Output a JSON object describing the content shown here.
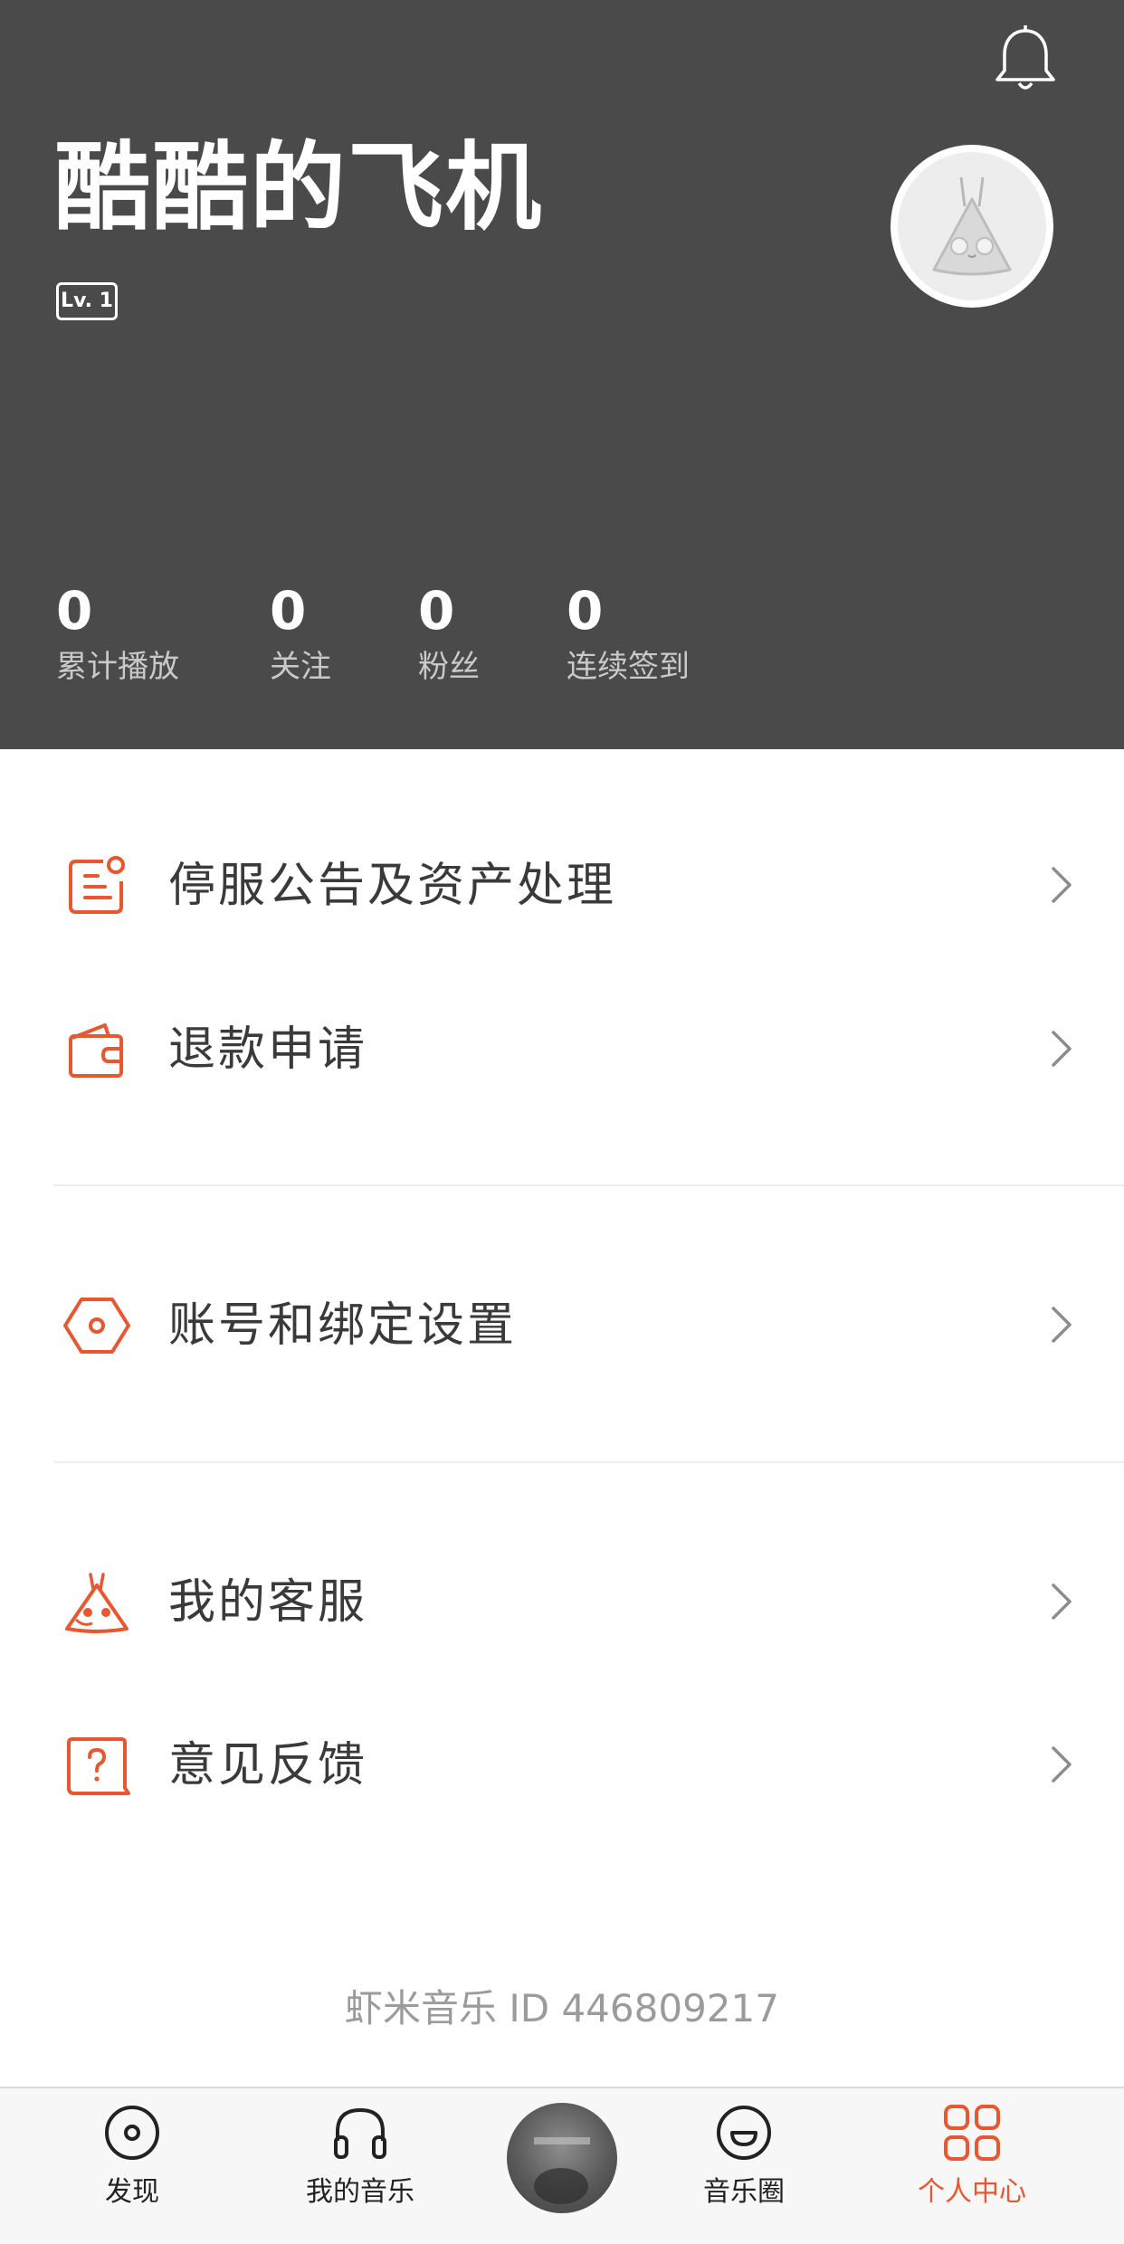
{
  "profile": {
    "username": "酷酷的飞机",
    "level": "Lv. 1"
  },
  "stats": [
    {
      "value": "0",
      "label": "累计播放"
    },
    {
      "value": "0",
      "label": "关注"
    },
    {
      "value": "0",
      "label": "粉丝"
    },
    {
      "value": "0",
      "label": "连续签到"
    }
  ],
  "menu": [
    {
      "label": "停服公告及资产处理",
      "icon": "notice-icon"
    },
    {
      "label": "退款申请",
      "icon": "wallet-icon"
    },
    {
      "label": "账号和绑定设置",
      "icon": "hexagon-settings-icon"
    },
    {
      "label": "我的客服",
      "icon": "mascot-service-icon"
    },
    {
      "label": "意见反馈",
      "icon": "feedback-question-icon"
    }
  ],
  "footer": {
    "xiami_id": "虾米音乐 ID 446809217"
  },
  "tabs": [
    {
      "label": "发现",
      "icon": "discover-disc-icon"
    },
    {
      "label": "我的音乐",
      "icon": "headphones-icon"
    },
    {
      "label": "",
      "icon": "now-playing-cover"
    },
    {
      "label": "音乐圈",
      "icon": "smile-icon"
    },
    {
      "label": "个人中心",
      "icon": "grid-icon",
      "active": true
    }
  ],
  "colors": {
    "accent": "#e8572f",
    "header_bg": "#4a4a4b"
  }
}
